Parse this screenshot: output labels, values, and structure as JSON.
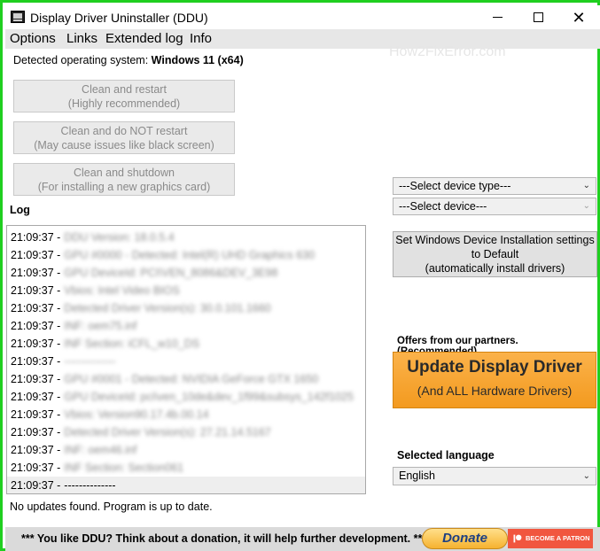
{
  "window": {
    "title": "Display Driver Uninstaller (DDU)",
    "min_glyph": "—",
    "max_glyph": "□",
    "close_glyph": "✕"
  },
  "menu": [
    {
      "label": "Options"
    },
    {
      "label": "Links"
    },
    {
      "label": "Extended log"
    },
    {
      "label": "Info"
    }
  ],
  "watermark": "How2FixError.com",
  "os": {
    "label": "Detected operating system:",
    "value": "Windows 11 (x64)"
  },
  "actions": [
    {
      "line1": "Clean and restart",
      "line2": "(Highly recommended)"
    },
    {
      "line1": "Clean and do NOT restart",
      "line2": "(May cause issues like black screen)"
    },
    {
      "line1": "Clean and shutdown",
      "line2": "(For installing a new graphics card)"
    }
  ],
  "log": {
    "title": "Log",
    "rows": [
      {
        "time": "21:09:37 -",
        "text": "DDU Version: 18.0.5.4"
      },
      {
        "time": "21:09:37 -",
        "text": "GPU #0000 - Detected: Intel(R) UHD Graphics 630"
      },
      {
        "time": "21:09:37 -",
        "text": "GPU DeviceId: PCI\\VEN_8086&DEV_3E98"
      },
      {
        "time": "21:09:37 -",
        "text": "Vbios: Intel Video BIOS"
      },
      {
        "time": "21:09:37 -",
        "text": "Detected Driver Version(s): 30.0.101.1660"
      },
      {
        "time": "21:09:37 -",
        "text": "INF: oem75.inf"
      },
      {
        "time": "21:09:37 -",
        "text": "INF Section: iCFL_w10_DS"
      },
      {
        "time": "21:09:37 -",
        "text": "--------------"
      },
      {
        "time": "21:09:37 -",
        "text": "GPU #0001 - Detected: NVIDIA GeForce GTX 1650"
      },
      {
        "time": "21:09:37 -",
        "text": "GPU DeviceId: pci\\ven_10de&dev_1f99&subsys_142f1025"
      },
      {
        "time": "21:09:37 -",
        "text": "Vbios: Version90.17.4b.00.14"
      },
      {
        "time": "21:09:37 -",
        "text": "Detected Driver Version(s): 27.21.14.5167"
      },
      {
        "time": "21:09:37 -",
        "text": "INF: oem46.inf"
      },
      {
        "time": "21:09:37 -",
        "text": "INF Section: Section061"
      }
    ],
    "last_row": {
      "time": "21:09:37 -",
      "text": "--------------"
    }
  },
  "status": "No updates found. Program is up to date.",
  "device_type": {
    "value": "---Select device type---"
  },
  "device": {
    "value": "---Select device---"
  },
  "wdi_button": {
    "line1": "Set Windows Device Installation settings",
    "line2": "to Default",
    "line3": "(automatically install drivers)"
  },
  "partners": {
    "label": "Offers from our partners. (Recommended)",
    "promo_main": "Update Display Driver",
    "promo_sub": "(And ALL Hardware Drivers)"
  },
  "language": {
    "label": "Selected language",
    "value": "English"
  },
  "footer": {
    "text": "*** You like DDU? Think about a donation, it will help further development. ***",
    "donate": "Donate",
    "patron": "BECOME A PATRON"
  },
  "colors": {
    "border": "#1fcf1f",
    "menubar": "#e7e7e7",
    "promo": "#f6a431",
    "patron": "#f1563f"
  }
}
